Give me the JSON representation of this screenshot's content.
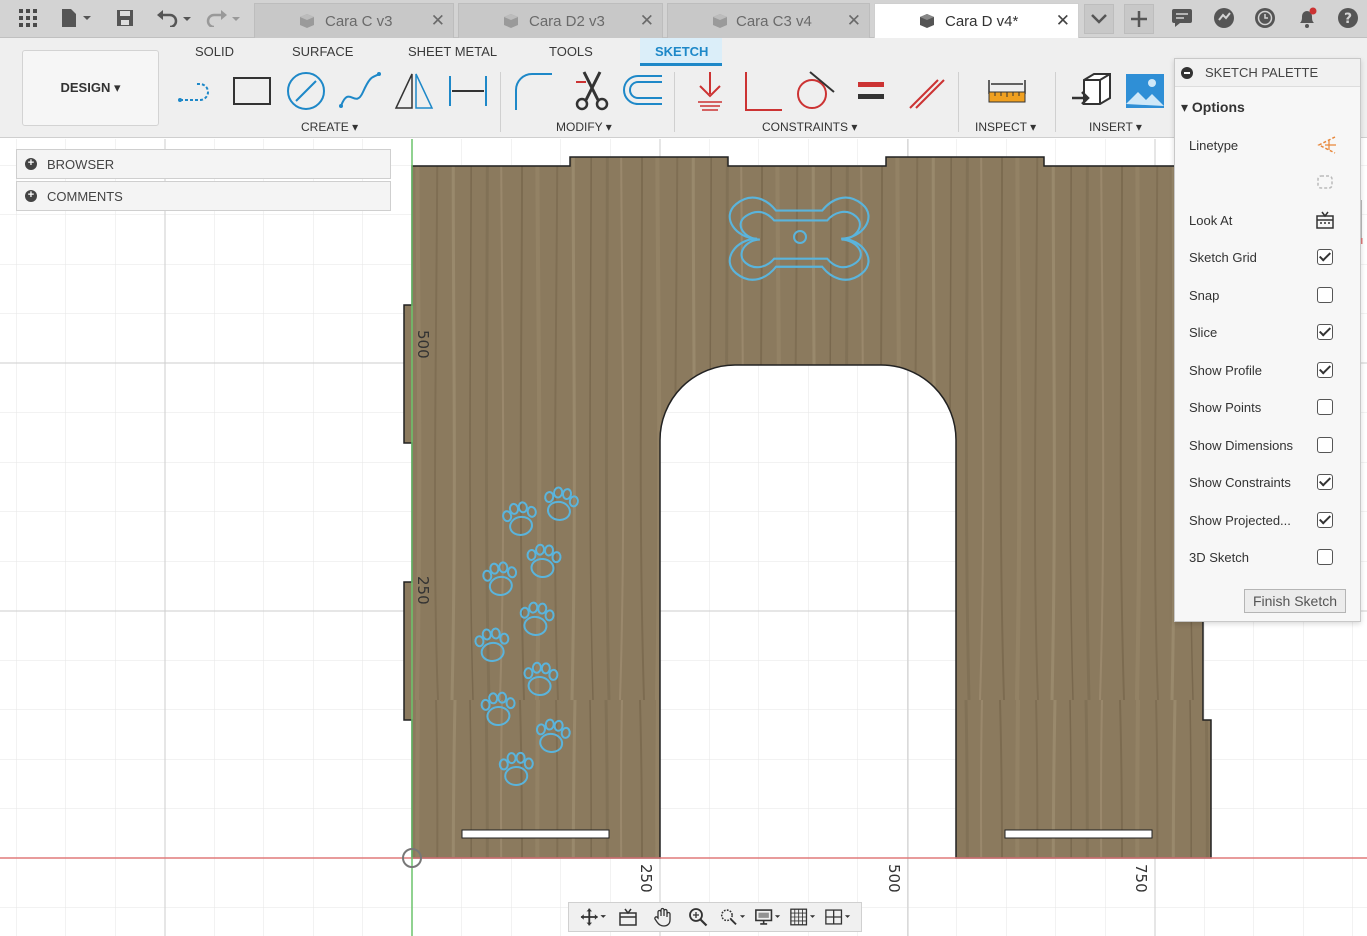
{
  "tabs": [
    {
      "label": "Cara C v3",
      "active": false
    },
    {
      "label": "Cara D2 v3",
      "active": false
    },
    {
      "label": "Cara C3 v4",
      "active": false
    },
    {
      "label": "Cara D v4*",
      "active": true
    }
  ],
  "toolbar": {
    "design_label": "DESIGN ▾",
    "workspace_tabs": [
      "SOLID",
      "SURFACE",
      "SHEET METAL",
      "TOOLS",
      "SKETCH"
    ],
    "groups": {
      "create": "CREATE ▾",
      "modify": "MODIFY ▾",
      "constraints": "CONSTRAINTS ▾",
      "inspect": "INSPECT ▾",
      "insert": "INSERT ▾"
    }
  },
  "left_panel": {
    "browser": "BROWSER",
    "comments": "COMMENTS"
  },
  "canvas": {
    "ruler_labels": {
      "v_500": "500",
      "v_250": "250",
      "h_250": "250",
      "h_500": "500",
      "h_750": "750"
    }
  },
  "palette": {
    "title": "SKETCH PALETTE",
    "options_header": "▾ Options",
    "rows": [
      {
        "label": "Linetype",
        "type": "icon"
      },
      {
        "label": "",
        "type": "icon"
      },
      {
        "label": "Look At",
        "type": "icon"
      },
      {
        "label": "Sketch Grid",
        "type": "check",
        "checked": true
      },
      {
        "label": "Snap",
        "type": "check",
        "checked": false
      },
      {
        "label": "Slice",
        "type": "check",
        "checked": true
      },
      {
        "label": "Show Profile",
        "type": "check",
        "checked": true
      },
      {
        "label": "Show Points",
        "type": "check",
        "checked": false
      },
      {
        "label": "Show Dimensions",
        "type": "check",
        "checked": false
      },
      {
        "label": "Show Constraints",
        "type": "check",
        "checked": true
      },
      {
        "label": "Show Projected...",
        "type": "check",
        "checked": true
      },
      {
        "label": "3D Sketch",
        "type": "check",
        "checked": false
      }
    ],
    "finish_label": "Finish Sketch"
  },
  "colors": {
    "accent": "#1e88c8",
    "wood": "#8b7a5e",
    "sketch_blue": "#5ab4dc",
    "axis_red": "#e07a7a",
    "axis_green": "#6cc46c"
  }
}
